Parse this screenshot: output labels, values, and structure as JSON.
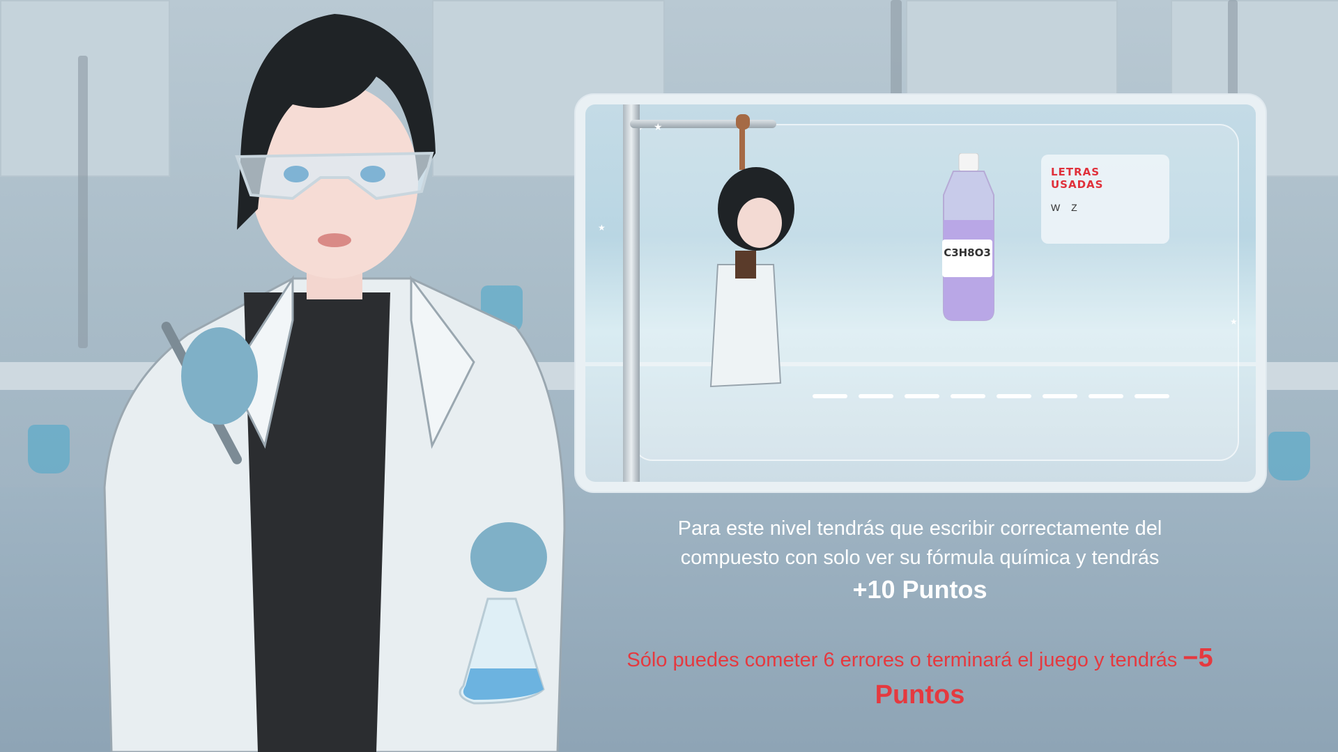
{
  "game": {
    "letters_panel": {
      "title": "LETRAS USADAS",
      "used": "W Z"
    },
    "bottle_label": "C3H8O3",
    "blank_count": 8
  },
  "instructions": {
    "line": "Para este nivel tendrás que escribir correctamente del compuesto con solo ver su fórmula química y tendrás",
    "reward": "+10 Puntos",
    "warning": "Sólo puedes cometer 6 errores o terminará el juego y tendrás",
    "penalty_value": "−5",
    "penalty_unit": "Puntos"
  },
  "colors": {
    "warning": "#e5393f",
    "letters_title": "#e0303a",
    "bottle_liquid": "#b9a7e6"
  },
  "icons": [
    "scientist-character",
    "hanging-character",
    "glycerol-bottle",
    "lab-stand"
  ]
}
